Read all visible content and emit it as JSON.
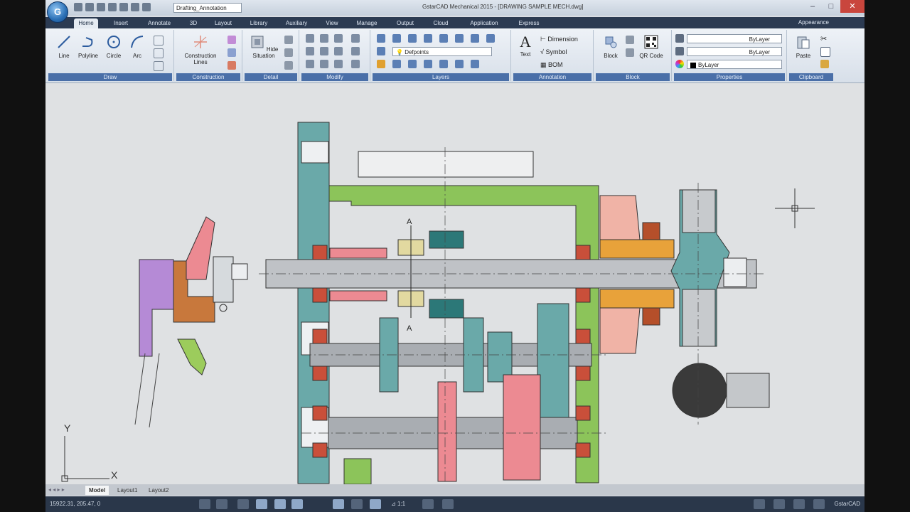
{
  "titlebar": {
    "app_menu_icon": "gstarcad-logo-icon",
    "workspace": "Drafting_Annotation",
    "window_title": "GstarCAD Mechanical 2015 - [DRAWING SAMPLE MECH.dwg]"
  },
  "tabs": [
    "Home",
    "Insert",
    "Annotate",
    "3D",
    "Layout",
    "Library",
    "Auxiliary",
    "View",
    "Manage",
    "Output",
    "Cloud",
    "Application",
    "Express"
  ],
  "appearance_label": "Appearance",
  "ribbon": {
    "draw": {
      "label": "Draw",
      "tools": [
        "Line",
        "Polyline",
        "Circle",
        "Arc"
      ]
    },
    "construction": {
      "label": "Construction",
      "tools": [
        "Construction Lines"
      ]
    },
    "detail": {
      "label": "Detail",
      "tools": [
        "Hide Situation"
      ]
    },
    "modify": {
      "label": "Modify"
    },
    "layers": {
      "label": "Layers",
      "current_layer": "Defpoints"
    },
    "annotation": {
      "label": "Annotation",
      "text_tool": "Text",
      "items": [
        "Dimension",
        "Symbol",
        "BOM"
      ]
    },
    "block": {
      "label": "Block",
      "tools": [
        "Block",
        "QR Code"
      ]
    },
    "properties": {
      "label": "Properties",
      "values": [
        "ByLayer",
        "ByLayer",
        "ByLayer"
      ]
    },
    "clipboard": {
      "label": "Clipboard",
      "tools": [
        "Paste"
      ]
    }
  },
  "drawing": {
    "section_label_top": "A",
    "section_label_bottom": "A",
    "ucs_x": "X",
    "ucs_y": "Y"
  },
  "layout_tabs": [
    "Model",
    "Layout1",
    "Layout2"
  ],
  "status": {
    "coordinates": "15922.31, 205.47, 0",
    "scale": "1:1",
    "brand": "GstarCAD"
  },
  "colors": {
    "accent": "#2c3b52",
    "teal": "#5fa8a8",
    "pink": "#e88e96",
    "green": "#8cc45a",
    "orange": "#e8a23a"
  }
}
